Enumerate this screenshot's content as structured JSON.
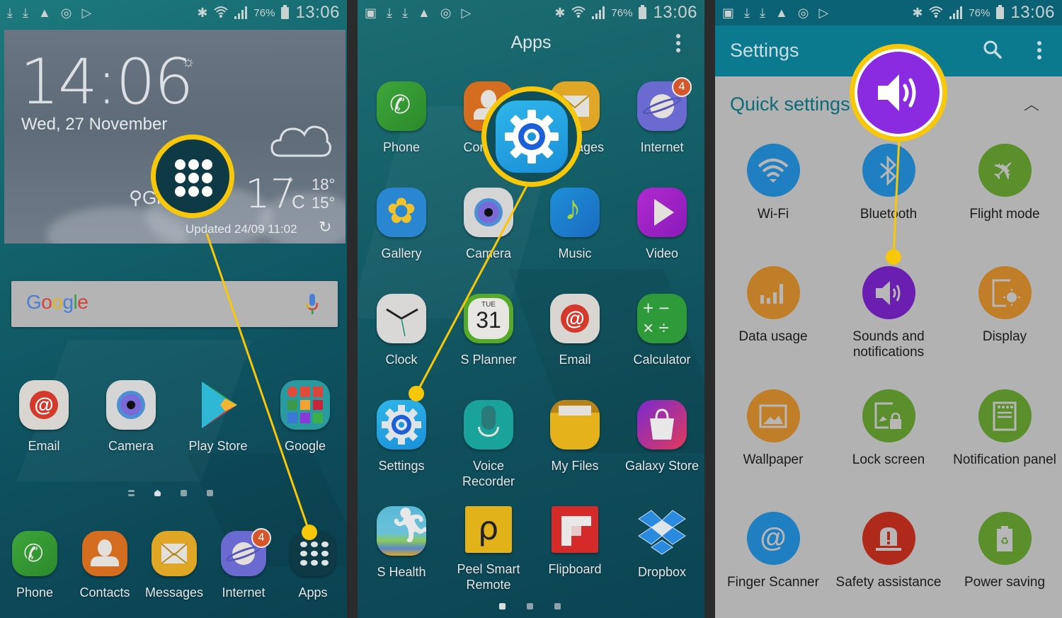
{
  "status_bar": {
    "battery_percent": "76%",
    "time": "13:06",
    "left_icons": [
      "download-icon",
      "download-icon",
      "warning-icon",
      "sync-icon",
      "play-store-notification-icon"
    ],
    "right_icons": [
      "bluetooth-icon",
      "wifi-icon",
      "signal-icon",
      "battery-icon"
    ]
  },
  "home_screen": {
    "weather_widget": {
      "time": "14:06",
      "date": "Wed, 27 November",
      "location": "Gl...n",
      "temperature": "17",
      "unit": "C",
      "degree": "°",
      "high": "18°",
      "low": "15°",
      "updated": "Updated 24/09 11:02",
      "condition_icon": "cloud-icon"
    },
    "search_bar": {
      "logo": [
        "G",
        "o",
        "o",
        "g",
        "l",
        "e"
      ],
      "logo_colors": [
        "#4a7fd6",
        "#d2443a",
        "#e2b51d",
        "#4a7fd6",
        "#3b9a4a",
        "#d2443a"
      ],
      "mic_icon": "mic-icon"
    },
    "apps": [
      {
        "label": "Email"
      },
      {
        "label": "Camera"
      },
      {
        "label": "Play Store"
      },
      {
        "label": "Google"
      }
    ],
    "dock": [
      {
        "label": "Phone"
      },
      {
        "label": "Contacts"
      },
      {
        "label": "Messages"
      },
      {
        "label": "Internet",
        "badge": "4"
      },
      {
        "label": "Apps"
      }
    ]
  },
  "apps_drawer": {
    "title": "Apps",
    "apps": [
      {
        "label": "Phone"
      },
      {
        "label": "Contacts"
      },
      {
        "label": "Messages"
      },
      {
        "label": "Internet",
        "badge": "4"
      },
      {
        "label": "Gallery"
      },
      {
        "label": "Camera"
      },
      {
        "label": "Music"
      },
      {
        "label": "Video"
      },
      {
        "label": "Clock"
      },
      {
        "label": "S Planner",
        "calendar_day": "TUE",
        "calendar_date": "31"
      },
      {
        "label": "Email"
      },
      {
        "label": "Calculator"
      },
      {
        "label": "Settings"
      },
      {
        "label": "Voice Recorder"
      },
      {
        "label": "My Files"
      },
      {
        "label": "Galaxy Store"
      },
      {
        "label": "S Health"
      },
      {
        "label": "Peel Smart Remote"
      },
      {
        "label": "Flipboard"
      },
      {
        "label": "Dropbox"
      }
    ],
    "page_count": 3,
    "current_page": 1
  },
  "settings": {
    "title": "Settings",
    "section_title": "Quick settings",
    "quick_settings": [
      {
        "label": "Wi-Fi",
        "icon": "wifi-icon",
        "color": "#1f7fc0"
      },
      {
        "label": "Bluetooth",
        "icon": "bluetooth-icon",
        "color": "#1f7fc0"
      },
      {
        "label": "Flight mode",
        "icon": "airplane-icon",
        "color": "#5a8f2c"
      },
      {
        "label": "Data usage",
        "icon": "data-usage-icon",
        "color": "#c07e28"
      },
      {
        "label": "Sounds and notifications",
        "icon": "speaker-icon",
        "color": "#6a1fb0"
      },
      {
        "label": "Display",
        "icon": "display-icon",
        "color": "#c07e28"
      },
      {
        "label": "Wallpaper",
        "icon": "wallpaper-icon",
        "color": "#c07e28"
      },
      {
        "label": "Lock screen",
        "icon": "lock-screen-icon",
        "color": "#5a8f2c"
      },
      {
        "label": "Notification panel",
        "icon": "notification-panel-icon",
        "color": "#5a8f2c"
      },
      {
        "label": "Finger Scanner",
        "icon": "fingerprint-icon",
        "color": "#1f7fc0"
      },
      {
        "label": "Safety assistance",
        "icon": "alert-beacon-icon",
        "color": "#b02a1c"
      },
      {
        "label": "Power saving",
        "icon": "battery-recycle-icon",
        "color": "#5a8f2c"
      }
    ]
  },
  "annotations": {
    "highlight_color": "#f7c70a"
  }
}
